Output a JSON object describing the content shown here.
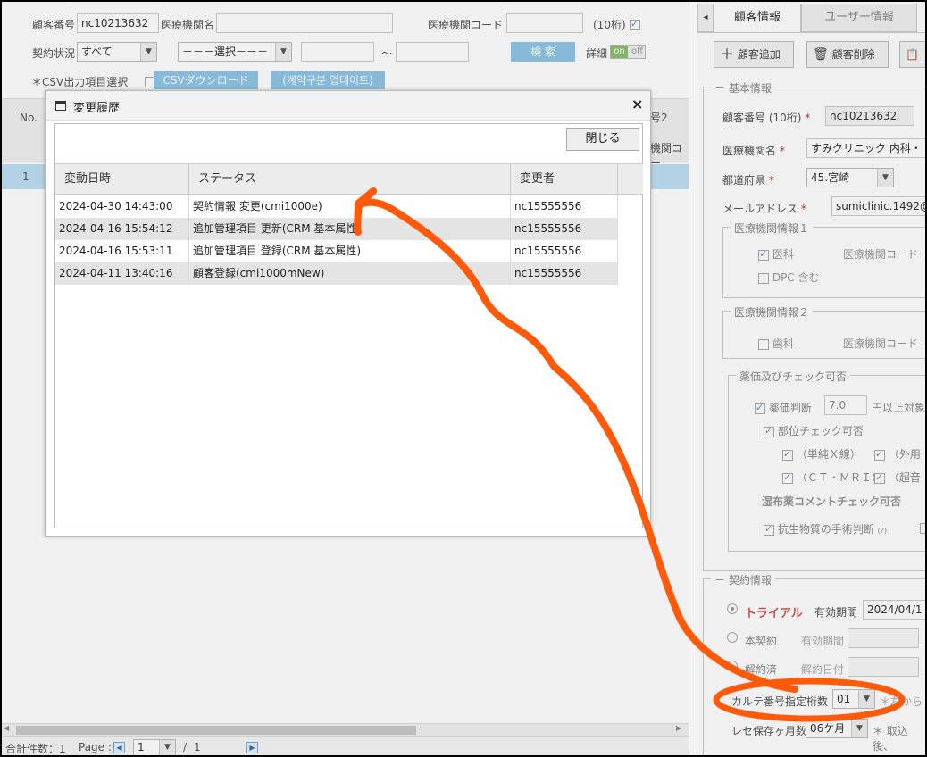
{
  "search": {
    "customer_no_label": "顧客番号",
    "customer_no_value": "nc10213632",
    "facility_name_label": "医療機関名",
    "facility_code_label": "医療機関コード",
    "digits_label": "(10桁)",
    "contract_status_label": "契約状況",
    "contract_status_value": "すべて",
    "select_placeholder": "－－－選択－－－",
    "tilde": "～",
    "search_button": "検 索",
    "detail_label": "詳細",
    "toggle_on": "on",
    "toggle_off": "off",
    "csv_item_label": "＊CSV出力項目選択",
    "csv_download_button": "CSVダウンロード",
    "contract_update_button": "(계약구분 업데이트)"
  },
  "grid": {
    "no_header": "No.",
    "partial_header_1": "機関コー",
    "partial_header_2": "号2",
    "row1_no": "1"
  },
  "footer": {
    "total_label": "合計件数：1",
    "page_label": "Page :",
    "page_value": "1",
    "page_sep": "/",
    "page_total": "1"
  },
  "dialog": {
    "title": "変更履歴",
    "close_x": "×",
    "close_button": "閉じる",
    "columns": [
      "変動日時",
      "ステータス",
      "変更者"
    ],
    "rows": [
      {
        "datetime": "2024-04-30 14:43:00",
        "status": "契約情報 変更(cmi1000e)",
        "user": "nc15555556"
      },
      {
        "datetime": "2024-04-16 15:54:12",
        "status": "追加管理項目 更新(CRM 基本属性)",
        "user": "nc15555556"
      },
      {
        "datetime": "2024-04-16 15:53:11",
        "status": "追加管理項目 登録(CRM 基本属性)",
        "user": "nc15555556"
      },
      {
        "datetime": "2024-04-11 13:40:16",
        "status": "顧客登録(cmi1000mNew)",
        "user": "nc15555556"
      }
    ]
  },
  "right": {
    "tab_arrow": "◂",
    "tab_customer": "顧客情報",
    "tab_user": "ユーザー情報",
    "add_button": "顧客追加",
    "delete_button": "顧客削除",
    "basic_info": "基本情報",
    "cust_no_label": "顧客番号 (10桁)",
    "cust_no_value": "nc10213632",
    "facility_name_label": "医療機関名",
    "facility_name_value": "すみクリニック 内科・",
    "pref_label": "都道府県",
    "pref_value": "45.宮崎",
    "email_label": "メールアドレス",
    "email_value": "sumiclinic.1492@",
    "med_info1": "医療機関情報１",
    "medical": "医科",
    "facility_code": "医療機関コード",
    "dpc": "DPC 含む",
    "med_info2": "医療機関情報２",
    "dental": "歯科",
    "drug_check": "薬価及びチェック可否",
    "drug_price": "薬価判断",
    "drug_price_value": "7.0",
    "drug_price_suffix": "円以上対象",
    "part_check": "部位チェック可否",
    "xray": "（単純Ｘ線）",
    "external": "（外用",
    "ct_mri": "（ＣＴ・ＭＲＩ）",
    "ultrasound": "（超音",
    "poultice": "湿布薬コメントチェック可否",
    "antibiotic": "抗生物質の手術判断",
    "antibiotic_q": "(?)",
    "contract_info": "契約情報",
    "trial": "トライアル",
    "valid_period": "有効期間",
    "valid_period_value": "2024/04/1",
    "main_contract": "本契約",
    "cancelled": "解約済",
    "cancel_date": "解約日付",
    "chart_digits": "カルテ番号指定桁数",
    "chart_digits_value": "01",
    "chart_digits_note": "＊左から",
    "rece_months": "レセ保存ヶ月数",
    "rece_months_value": "06ケ月",
    "rece_note": "＊ 取込後、"
  },
  "colors": {
    "accent_blue": "#8fc6e6",
    "annotation_orange": "#ff5a0a",
    "selected_row": "#bfe0f5"
  }
}
